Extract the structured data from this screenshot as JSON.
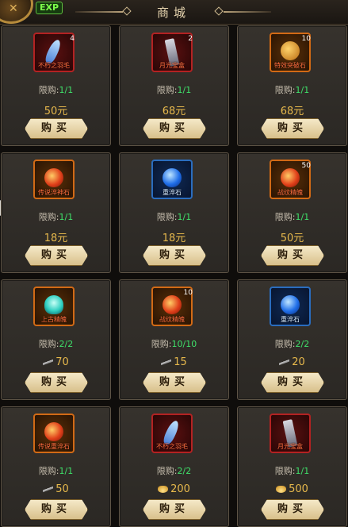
{
  "header": {
    "exp_label": "EXP",
    "title": "商城"
  },
  "items": [
    {
      "name": "不朽之羽毛",
      "count": "4",
      "limit_label": "限购:",
      "limit_value": "1/1",
      "price_type": "rmb",
      "price": "50元",
      "buy_label": "购买",
      "rarity": "red",
      "gem": "feather"
    },
    {
      "name": "月光宝盒",
      "count": "2",
      "limit_label": "限购:",
      "limit_value": "1/1",
      "price_type": "rmb",
      "price": "68元",
      "buy_label": "购买",
      "rarity": "red",
      "gem": "scroll"
    },
    {
      "name": "特效突破石",
      "count": "10",
      "limit_label": "限购:",
      "limit_value": "1/1",
      "price_type": "rmb",
      "price": "68元",
      "buy_label": "购买",
      "rarity": "orange",
      "gem": "nugget"
    },
    {
      "name": "传说淬神石",
      "count": "",
      "limit_label": "限购:",
      "limit_value": "1/1",
      "price_type": "rmb",
      "price": "18元",
      "buy_label": "购买",
      "rarity": "orange",
      "gem": "fire"
    },
    {
      "name": "重淬石",
      "count": "",
      "limit_label": "限购:",
      "limit_value": "1/1",
      "price_type": "rmb",
      "price": "18元",
      "buy_label": "购买",
      "rarity": "blue",
      "gem": "bluepearl"
    },
    {
      "name": "战纹精魄",
      "count": "50",
      "limit_label": "限购:",
      "limit_value": "1/1",
      "price_type": "rmb",
      "price": "50元",
      "buy_label": "购买",
      "rarity": "orange",
      "gem": "fire"
    },
    {
      "name": "上古精魄",
      "count": "",
      "limit_label": "限购:",
      "limit_value": "2/2",
      "price_type": "knife",
      "price": "70",
      "buy_label": "购买",
      "rarity": "orange",
      "gem": "cyanflame"
    },
    {
      "name": "战纹精魄",
      "count": "10",
      "limit_label": "限购:",
      "limit_value": "10/10",
      "price_type": "knife",
      "price": "15",
      "buy_label": "购买",
      "rarity": "orange",
      "gem": "fire"
    },
    {
      "name": "重淬石",
      "count": "",
      "limit_label": "限购:",
      "limit_value": "2/2",
      "price_type": "knife",
      "price": "20",
      "buy_label": "购买",
      "rarity": "blue",
      "gem": "bluepearl"
    },
    {
      "name": "传说重淬石",
      "count": "",
      "limit_label": "限购:",
      "limit_value": "1/1",
      "price_type": "knife",
      "price": "50",
      "buy_label": "购买",
      "rarity": "orange",
      "gem": "fire"
    },
    {
      "name": "不朽之羽毛",
      "count": "",
      "limit_label": "限购:",
      "limit_value": "2/2",
      "price_type": "ingot",
      "price": "200",
      "buy_label": "购买",
      "rarity": "red",
      "gem": "feather"
    },
    {
      "name": "月光宝盒",
      "count": "",
      "limit_label": "限购:",
      "limit_value": "1/1",
      "price_type": "ingot",
      "price": "500",
      "buy_label": "购买",
      "rarity": "red",
      "gem": "scroll"
    }
  ]
}
